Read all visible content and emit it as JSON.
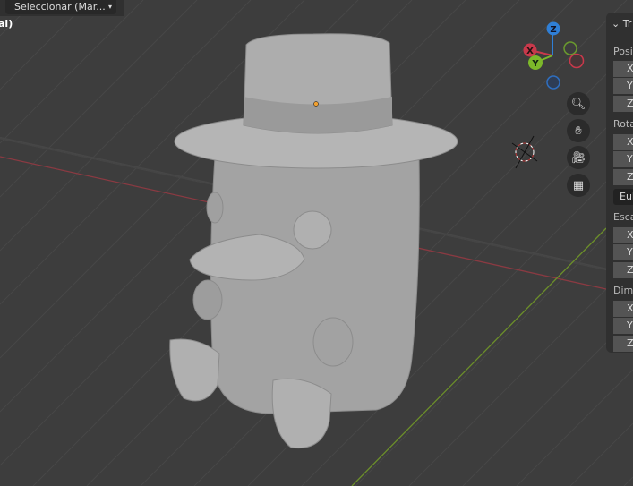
{
  "header": {
    "mode_select": "Seleccionar (Mar...",
    "view_label": "al)"
  },
  "gizmo": {
    "x": "X",
    "y": "Y",
    "z": "Z",
    "colors": {
      "x": "#c8394b",
      "y": "#7cb82a",
      "z": "#2f7fd6"
    }
  },
  "nav_buttons": [
    "zoom-icon",
    "hand-pan-icon",
    "camera-icon",
    "grid-perspective-icon"
  ],
  "panel": {
    "title": "Tr",
    "location": {
      "label": "Posi",
      "fields": [
        "X",
        "Y",
        "Z"
      ]
    },
    "rotation": {
      "label": "Rota",
      "fields": [
        "X",
        "Y",
        "Z"
      ]
    },
    "rotation_mode": "Eul",
    "scale": {
      "label": "Esca",
      "fields": [
        "X",
        "Y",
        "Z"
      ]
    },
    "dimensions": {
      "label": "Dime",
      "fields": [
        "X",
        "Y",
        "Z"
      ]
    }
  }
}
